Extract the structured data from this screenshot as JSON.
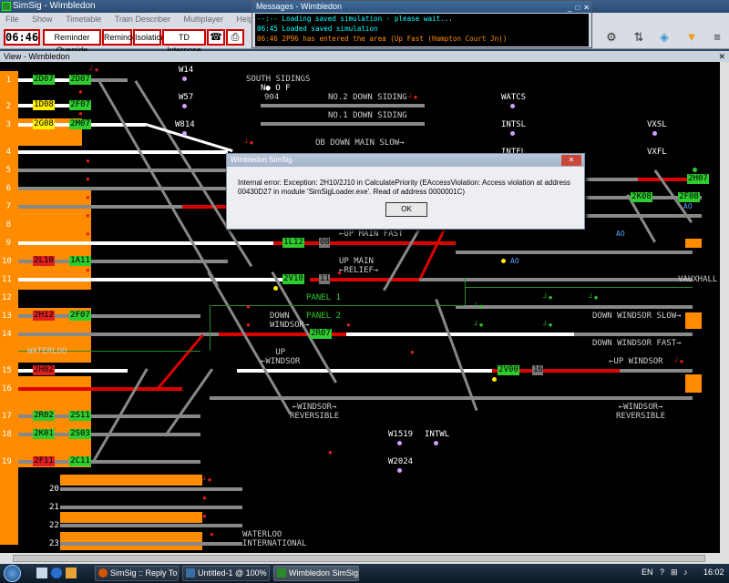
{
  "app": {
    "title": "SimSig - Wimbledon",
    "menu": [
      "File",
      "Show",
      "Timetable",
      "Train Describer",
      "Multiplayer",
      "Help"
    ],
    "clock": "06:46",
    "toolbar_buttons": [
      "Reminder Override",
      "Reminder",
      "Isolation",
      "TD Interpose"
    ],
    "toolbar_icons": [
      "telephone-icon",
      "printer-icon"
    ],
    "view_title": "View - Wimbledon"
  },
  "messages": {
    "title": "Messages - Wimbledon",
    "lines": [
      {
        "text": "--:-- Loading saved simulation - please wait...",
        "color": "#00ffff"
      },
      {
        "text": "06:45 Loaded saved simulation",
        "color": "#00ffff"
      },
      {
        "text": "06:46 2P96 has entered the area (Up Fast (Hampton Court Jn))",
        "color": "#ff8c00"
      }
    ]
  },
  "dialog": {
    "title": "Wimbledon SimSig",
    "message": "Internal error: Exception: 2H10/2J10 in CalculatePriority (EAccessViolation: Access violation at address 00430D27 in module 'SimSigLoader.exe'. Read of address 0000001C)",
    "ok_label": "OK"
  },
  "track_numbers": [
    "1",
    "2",
    "3",
    "4",
    "5",
    "6",
    "7",
    "8",
    "9",
    "10",
    "11",
    "12",
    "13",
    "14",
    "15",
    "16",
    "17",
    "18",
    "19",
    "20",
    "21",
    "22",
    "23"
  ],
  "berths": [
    {
      "id": "b1a",
      "text": "2D07",
      "color": "green"
    },
    {
      "id": "b1b",
      "text": "2D07",
      "color": "green"
    },
    {
      "id": "b2a",
      "text": "1D08",
      "color": "yellow"
    },
    {
      "id": "b2b",
      "text": "2F07",
      "color": "green"
    },
    {
      "id": "b3a",
      "text": "2G08",
      "color": "yellow"
    },
    {
      "id": "b3b",
      "text": "2M07",
      "color": "green"
    },
    {
      "id": "b10a",
      "text": "2L10",
      "color": "red"
    },
    {
      "id": "b10b",
      "text": "1A11",
      "color": "green"
    },
    {
      "id": "b12a",
      "text": "2H12",
      "color": "red"
    },
    {
      "id": "b12b",
      "text": "2F07",
      "color": "green"
    },
    {
      "id": "b15",
      "text": "2H02",
      "color": "red"
    },
    {
      "id": "b17a",
      "text": "2R02",
      "color": "green"
    },
    {
      "id": "b17b",
      "text": "2S11",
      "color": "green"
    },
    {
      "id": "b18a",
      "text": "2K01",
      "color": "green"
    },
    {
      "id": "b18b",
      "text": "2S03",
      "color": "green"
    },
    {
      "id": "b19a",
      "text": "2F11",
      "color": "red"
    },
    {
      "id": "b19b",
      "text": "2C11",
      "color": "green"
    },
    {
      "id": "c1",
      "text": "1L12",
      "color": "green"
    },
    {
      "id": "c2",
      "text": "2V10",
      "color": "green"
    },
    {
      "id": "c3",
      "text": "2R07",
      "color": "green"
    },
    {
      "id": "c4",
      "text": "2K08",
      "color": "green"
    },
    {
      "id": "c5",
      "text": "2F08",
      "color": "green"
    },
    {
      "id": "c6",
      "text": "2H07",
      "color": "green"
    },
    {
      "id": "c7",
      "text": "2V00",
      "color": "green"
    }
  ],
  "labels": {
    "south_sidings": "SOUTH SIDINGS",
    "s904": "904",
    "no_f": "N● O F",
    "no2_down_siding": "NO.2 DOWN SIDING",
    "no1_down_siding": "NO.1 DOWN SIDING",
    "down_main_slow": "OB DOWN MAIN SLOW→",
    "up_main_fast": "←UP MAIN FAST",
    "up_main_relief": "UP MAIN\n←RELIEF→",
    "panel1": "PANEL 1",
    "panel2": "PANEL 2",
    "down_windsor": "DOWN\nWINDSOR→",
    "up_windsor": "UP\n←WINDSOR",
    "up_windsor_right": "←UP WINDSOR",
    "down_windsor_slow": "DOWN WINDSOR SLOW→",
    "down_windsor_fast": "DOWN WINDSOR FAST→",
    "windsor_reversible_1": "←WINDSOR→\nREVERSIBLE",
    "windsor_reversible_2": "←WINDSOR→\nREVERSIBLE",
    "waterloo": "WATERLOO",
    "waterloo_international": "WATERLOO\nINTERNATIONAL",
    "vauxhall": "VAUXHALL",
    "w14": "W14",
    "w57": "W57",
    "w814": "W814",
    "watcs": "WATCS",
    "intsl": "INTSL",
    "intfl": "INTFL",
    "vxsl": "VXSL",
    "vxfl": "VXFL",
    "w1519": "W1519",
    "intwl": "INTWL",
    "w2024": "W2024",
    "ao": "AO"
  },
  "taskbar": {
    "tasks": [
      {
        "label": "SimSig :: Reply Topi...",
        "active": false
      },
      {
        "label": "Untitled-1 @ 100% (...",
        "active": false
      },
      {
        "label": "Wimbledon SimSig",
        "active": true
      }
    ],
    "lang": "EN",
    "time": "16:02"
  }
}
